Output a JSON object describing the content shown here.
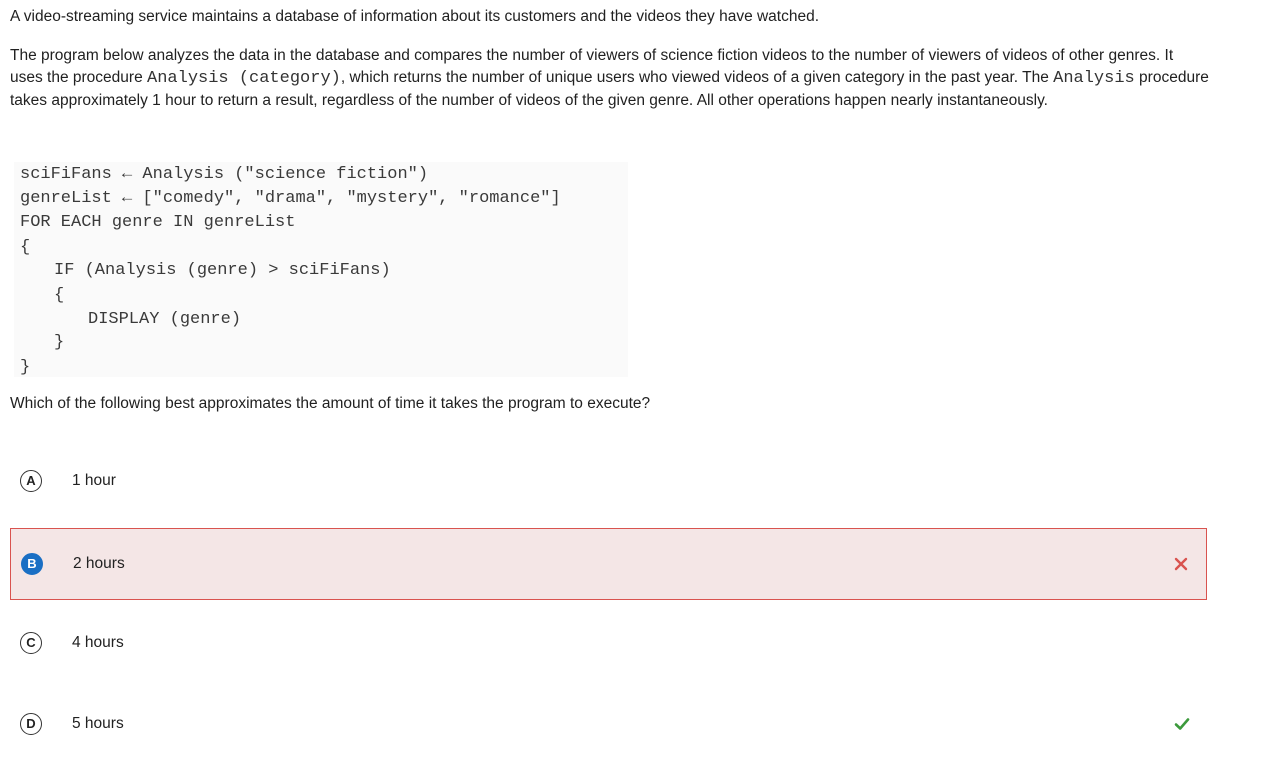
{
  "intro": "A video-streaming service maintains a database of information about its customers and the videos they have watched.",
  "paragraph": {
    "part1": "The program below analyzes the data in the database and compares the number of viewers of science fiction videos to the number of viewers of videos of other genres. It uses the procedure ",
    "code1": "Analysis (category)",
    "part2": ", which returns the number of unique users who viewed videos of a given category in the past year. The ",
    "code2": "Analysis",
    "part3": " procedure takes approximately 1 hour to return a result, regardless of the number of videos of the given genre. All other operations happen nearly instantaneously."
  },
  "code": {
    "line1": "sciFiFans ← Analysis (\"science fiction\")",
    "line2": "genreList ← [\"comedy\", \"drama\", \"mystery\", \"romance\"]",
    "line3": "FOR EACH genre IN genreList",
    "line4": "{",
    "line5": "IF (Analysis (genre) > sciFiFans)",
    "line6": "{",
    "line7": "DISPLAY (genre)",
    "line8": "}",
    "line9": "}"
  },
  "question": "Which of the following best approximates the amount of time it takes the program to execute?",
  "choices": [
    {
      "letter": "A",
      "label": "1 hour",
      "state": "unselected"
    },
    {
      "letter": "B",
      "label": "2 hours",
      "state": "selected-incorrect"
    },
    {
      "letter": "C",
      "label": "4 hours",
      "state": "unselected"
    },
    {
      "letter": "D",
      "label": "5 hours",
      "state": "correct"
    }
  ],
  "colors": {
    "wrong": "#d9534f",
    "wrong_bg": "#f4e6e6",
    "correct": "#3c9a3c",
    "selected_badge": "#1a6fc4"
  },
  "icons": {
    "wrong_mark": "close-icon",
    "correct_mark": "check-icon"
  }
}
